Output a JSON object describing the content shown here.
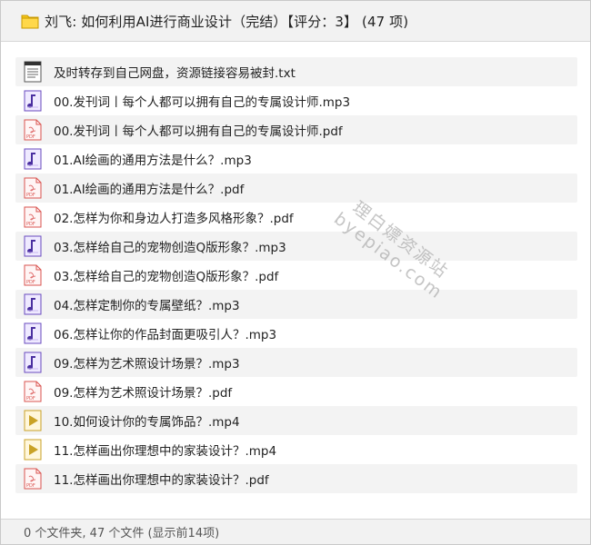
{
  "header": {
    "title": "刘飞: 如何利用AI进行商业设计（完结）【评分：3】 (47 项)",
    "icon": "folder-icon"
  },
  "files": [
    {
      "name": "及时转存到自己网盘，资源链接容易被封.txt",
      "type": "txt"
    },
    {
      "name": "00.发刊词丨每个人都可以拥有自己的专属设计师.mp3",
      "type": "mp3"
    },
    {
      "name": "00.发刊词丨每个人都可以拥有自己的专属设计师.pdf",
      "type": "pdf"
    },
    {
      "name": "01.AI绘画的通用方法是什么？.mp3",
      "type": "mp3"
    },
    {
      "name": "01.AI绘画的通用方法是什么？.pdf",
      "type": "pdf"
    },
    {
      "name": "02.怎样为你和身边人打造多风格形象？.pdf",
      "type": "pdf"
    },
    {
      "name": "03.怎样给自己的宠物创造Q版形象？.mp3",
      "type": "mp3"
    },
    {
      "name": "03.怎样给自己的宠物创造Q版形象？.pdf",
      "type": "pdf"
    },
    {
      "name": "04.怎样定制你的专属壁纸？.mp3",
      "type": "mp3"
    },
    {
      "name": "06.怎样让你的作品封面更吸引人？.mp3",
      "type": "mp3"
    },
    {
      "name": "09.怎样为艺术照设计场景？.mp3",
      "type": "mp3"
    },
    {
      "name": "09.怎样为艺术照设计场景？.pdf",
      "type": "pdf"
    },
    {
      "name": "10.如何设计你的专属饰品？.mp4",
      "type": "mp4"
    },
    {
      "name": "11.怎样画出你理想中的家装设计？.mp4",
      "type": "mp4"
    },
    {
      "name": "11.怎样画出你理想中的家装设计？.pdf",
      "type": "pdf"
    }
  ],
  "footer": {
    "summary": "0 个文件夹, 47 个文件 (显示前14项)"
  },
  "watermark": {
    "line1": "理白嫖资源站",
    "line2": "byepiao.com"
  },
  "colors": {
    "header_bg": "#f2f2f2",
    "row_alt_bg": "#f3f3f3",
    "pdf_red": "#d9534f",
    "mp3_purple": "#6a4bbf",
    "mp4_gold": "#c9a227"
  }
}
